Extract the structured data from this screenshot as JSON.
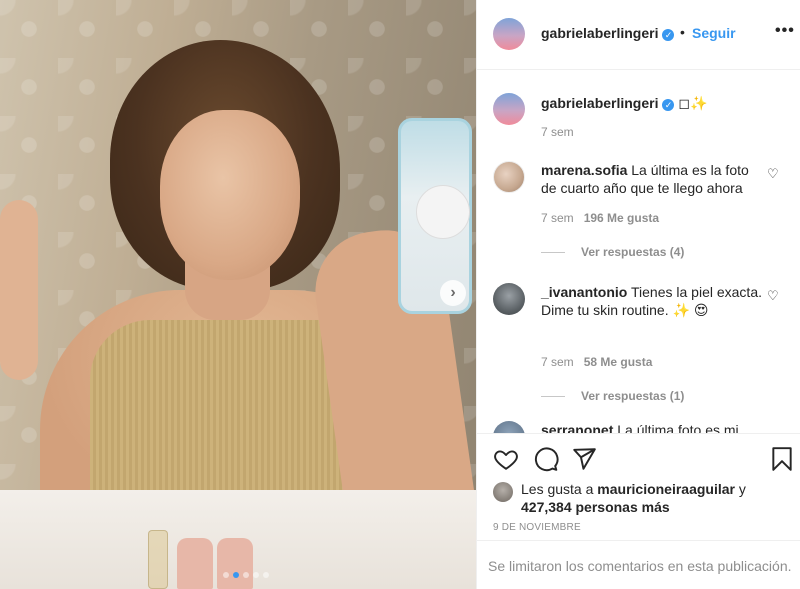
{
  "post": {
    "username": "gabrielaberlingeri",
    "follow_label": "Seguir",
    "separator": "•",
    "more_label": "•••",
    "verified_icon": "verified-badge-icon",
    "caption_emoji": "◻✨",
    "caption_time": "7 sem"
  },
  "carousel": {
    "next_label": "›",
    "dots": 5,
    "active_dot": 1
  },
  "comments": [
    {
      "username": "marena.sofia",
      "text": "La última es la foto de cuarto año que te llego ahora",
      "time": "7 sem",
      "likes": "196 Me gusta",
      "replies": "Ver respuestas (4)"
    },
    {
      "username": "_ivanantonio",
      "text": "Tienes la piel exacta. Dime tu skin routine. ✨ 😍",
      "time": "7 sem",
      "likes": "58 Me gusta",
      "replies": "Ver respuestas (1)"
    },
    {
      "username": "serranonet",
      "text": "La última foto es mi"
    }
  ],
  "actions": {
    "liked_by_prefix": "Les gusta a",
    "liked_by_user": "mauricioneiraaguilar",
    "liked_by_and": "y",
    "liked_by_others": "427,384 personas más",
    "date": "9 DE NOVIEMBRE",
    "comments_limited": "Se limitaron los comentarios en esta publicación."
  },
  "colors": {
    "accent": "#3897f0",
    "text": "#262626",
    "muted": "#8e8e8e",
    "border": "#efefef"
  }
}
